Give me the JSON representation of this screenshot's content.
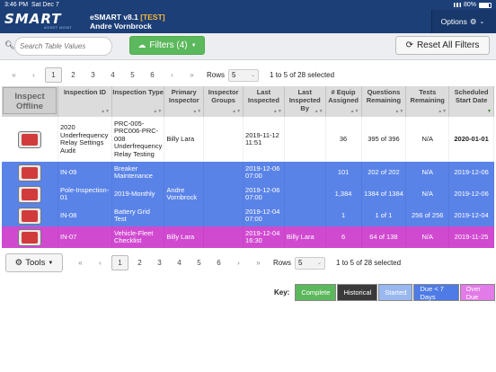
{
  "status_bar": {
    "time": "3:46 PM",
    "date": "Sat Dec 7",
    "battery": "80%"
  },
  "header": {
    "logo_text": "SMART",
    "logo_sub": "ASSET MGMT",
    "app_name": "eSMART v8.1 ",
    "env_tag": "[TEST]",
    "user": "Andre Vornbrock",
    "options_label": "Options"
  },
  "toolbar": {
    "search_placeholder": "Search Table Values",
    "filters_label": "Filters (4)",
    "reset_label": "Reset All Filters"
  },
  "pagination": {
    "pages": [
      "1",
      "2",
      "3",
      "4",
      "5",
      "6"
    ],
    "active_page": "1",
    "rows_label": "Rows",
    "rows_value": "5",
    "count_text": "1 to 5 of 28 selected"
  },
  "table": {
    "inspect_offline_label": "Inspect Offline",
    "columns": [
      "Inspection ID",
      "Inspection Type",
      "Primary Inspector",
      "Inspector Groups",
      "Last Inspected",
      "Last Inspected By",
      "# Equip Assigned",
      "Questions Remaining",
      "Tests Remaining",
      "Scheduled Start Date"
    ],
    "rows": [
      {
        "status": "white",
        "id": "2020 Underfrequency Relay Settings Audit",
        "type": "PRC-005-PRC006-PRC-008 Underfrequency Relay Testing",
        "primary": "Billy Lara",
        "groups": "",
        "last": "2019-11-12 11:51",
        "last_by": "",
        "equip": "36",
        "questions": "395 of 396",
        "tests": "N/A",
        "start": "2020-01-01"
      },
      {
        "status": "blue",
        "id": "IN-09",
        "type": "Breaker Maintenance",
        "primary": "",
        "groups": "",
        "last": "2019-12-06 07:00",
        "last_by": "",
        "equip": "101",
        "questions": "202 of 202",
        "tests": "N/A",
        "start": "2019-12-06"
      },
      {
        "status": "blue",
        "id": "Pole-Inspection-01",
        "type": "2019-Monthly",
        "primary": "Andre Vornbrock",
        "groups": "",
        "last": "2019-12-06 07:00",
        "last_by": "",
        "equip": "1,384",
        "questions": "1384 of 1384",
        "tests": "N/A",
        "start": "2019-12-06"
      },
      {
        "status": "blue",
        "id": "IN-08",
        "type": "Battery Grid Test",
        "primary": "",
        "groups": "",
        "last": "2019-12-04 07:00",
        "last_by": "",
        "equip": "1",
        "questions": "1 of 1",
        "tests": "256 of 256",
        "start": "2019-12-04"
      },
      {
        "status": "magenta",
        "id": "IN-07",
        "type": "Vehicle-Fleet Checklist",
        "primary": "Billy Lara",
        "groups": "",
        "last": "2019-12-04 16:30",
        "last_by": "Billy Lara",
        "equip": "6",
        "questions": "64 of 138",
        "tests": "N/A",
        "start": "2019-11-25"
      }
    ]
  },
  "tools_label": "Tools",
  "legend": {
    "label": "Key:",
    "items": [
      {
        "label": "Complete",
        "bg": "#5cb85c",
        "fg": "#ffffff"
      },
      {
        "label": "Historical",
        "bg": "#3a3a3a",
        "fg": "#ffffff"
      },
      {
        "label": "Started",
        "bg": "#9ab8f0",
        "fg": "#ffffff"
      },
      {
        "label": "Due < 7 Days",
        "bg": "#4e7be6",
        "fg": "#ffffff"
      },
      {
        "label": "Over Due",
        "bg": "#e27be8",
        "fg": "#ffffff"
      }
    ]
  },
  "colors": {
    "header": "#1d3f77",
    "row_blue": "#5a83e8",
    "row_magenta": "#d04ad0",
    "launch_red": "#d23b3b"
  }
}
